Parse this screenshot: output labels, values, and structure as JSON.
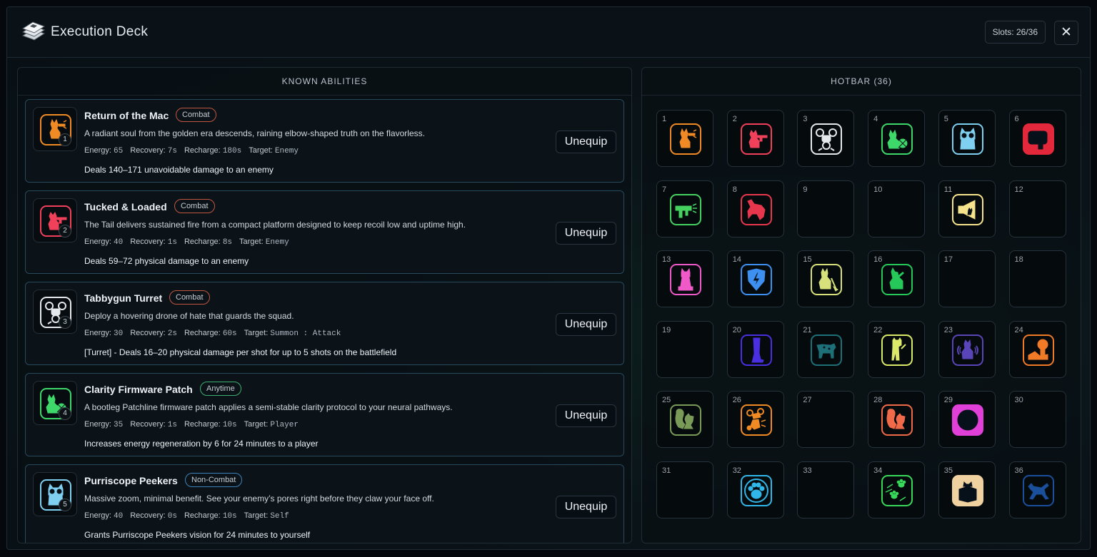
{
  "header": {
    "title": "Execution Deck",
    "slots": "Slots: 26/36",
    "close": "✕"
  },
  "known": {
    "title": "KNOWN ABILITIES"
  },
  "hotbar": {
    "title": "HOTBAR (36)"
  },
  "labels": {
    "energy": "Energy:",
    "recovery": "Recovery:",
    "recharge": "Recharge:",
    "target": "Target:",
    "unequip": "Unequip"
  },
  "abilities": [
    {
      "name": "Return of the Mac",
      "tag": "Combat",
      "tag_kind": "combat",
      "slot": "1",
      "desc": "A radiant soul from the golden era descends, raining elbow-shaped truth on the flavorless.",
      "energy": "65",
      "recovery": "7s",
      "recharge": "180s",
      "target": "Enemy",
      "effect": "Deals 140–171 unavoidable damage to an enemy",
      "color": "#f08a24",
      "icon": "cat-gun-icon"
    },
    {
      "name": "Tucked & Loaded",
      "tag": "Combat",
      "tag_kind": "combat",
      "slot": "2",
      "desc": "The Tail delivers sustained fire from a compact platform designed to keep recoil low and uptime high.",
      "energy": "40",
      "recovery": "1s",
      "recharge": "8s",
      "target": "Enemy",
      "effect": "Deals 59–72 physical damage to an enemy",
      "color": "#f0405a",
      "icon": "cat-rifle-icon"
    },
    {
      "name": "Tabbygun Turret",
      "tag": "Combat",
      "tag_kind": "combat",
      "slot": "3",
      "desc": "Deploy a hovering drone of hate that guards the squad.",
      "energy": "30",
      "recovery": "2s",
      "recharge": "60s",
      "target": "Summon : Attack",
      "effect": "[Turret] - Deals 16–20 physical damage per shot for up to 5 shots on the battlefield",
      "color": "#e6e9ec",
      "icon": "drone-icon"
    },
    {
      "name": "Clarity Firmware Patch",
      "tag": "Anytime",
      "tag_kind": "anytime",
      "slot": "4",
      "desc": "A bootleg Patchline firmware patch applies a semi-stable clarity protocol to your neural pathways.",
      "energy": "35",
      "recovery": "1s",
      "recharge": "10s",
      "target": "Player",
      "effect": "Increases energy regeneration by 6 for 24 minutes to a player",
      "color": "#3ed86a",
      "icon": "cat-chip-icon"
    },
    {
      "name": "Purriscope Peekers",
      "tag": "Non-Combat",
      "tag_kind": "noncombat",
      "slot": "5",
      "desc": "Massive zoom, minimal benefit. See your enemy’s pores right before they claw your face off.",
      "energy": "40",
      "recovery": "0s",
      "recharge": "10s",
      "target": "Self",
      "effect": "Grants Purriscope Peekers vision for 24 minutes to yourself",
      "color": "#7fcff0",
      "icon": "cat-goggles-icon"
    }
  ],
  "slots": [
    {
      "n": "1",
      "color": "#f08a24",
      "icon": "cat-gun-icon",
      "fill": false
    },
    {
      "n": "2",
      "color": "#f0405a",
      "icon": "cat-rifle-icon",
      "fill": false
    },
    {
      "n": "3",
      "color": "#e6e9ec",
      "icon": "drone-icon",
      "fill": false
    },
    {
      "n": "4",
      "color": "#3ed86a",
      "icon": "cat-chip-icon",
      "fill": false
    },
    {
      "n": "5",
      "color": "#7fcff0",
      "icon": "cat-goggles-icon",
      "fill": false
    },
    {
      "n": "6",
      "color": "#e3283c",
      "icon": "launcher-icon",
      "fill": true
    },
    {
      "n": "7",
      "color": "#45d160",
      "icon": "smg-icon",
      "fill": false
    },
    {
      "n": "8",
      "color": "#e8364c",
      "icon": "pouncing-cat-icon",
      "fill": false
    },
    {
      "n": "9",
      "empty": true
    },
    {
      "n": "10",
      "empty": true
    },
    {
      "n": "11",
      "color": "#f6e48c",
      "icon": "cat-megaphone-icon",
      "fill": false
    },
    {
      "n": "12",
      "empty": true
    },
    {
      "n": "13",
      "color": "#ef5ac8",
      "icon": "cat-statue-icon",
      "fill": false
    },
    {
      "n": "14",
      "color": "#3d8ff0",
      "icon": "shield-bolt-icon",
      "fill": false
    },
    {
      "n": "15",
      "color": "#d7e07a",
      "icon": "cat-broom-icon",
      "fill": false
    },
    {
      "n": "16",
      "color": "#26c85a",
      "icon": "cat-grooming-icon",
      "fill": false
    },
    {
      "n": "17",
      "empty": true
    },
    {
      "n": "18",
      "empty": true
    },
    {
      "n": "19",
      "empty": true
    },
    {
      "n": "20",
      "color": "#4a2fe0",
      "icon": "cat-leg-icon",
      "fill": false
    },
    {
      "n": "21",
      "color": "#1d6f78",
      "icon": "cow-icon",
      "fill": false
    },
    {
      "n": "22",
      "color": "#dcea6a",
      "icon": "standing-cat-icon",
      "fill": false
    },
    {
      "n": "23",
      "color": "#5a45b8",
      "icon": "cat-radar-icon",
      "fill": false
    },
    {
      "n": "24",
      "color": "#f07a26",
      "icon": "explosion-icon",
      "fill": false
    },
    {
      "n": "25",
      "color": "#7a9a58",
      "icon": "squirrel-icon",
      "fill": false
    },
    {
      "n": "26",
      "color": "#f08a24",
      "icon": "cat-drone-strike-icon",
      "fill": false
    },
    {
      "n": "27",
      "empty": true
    },
    {
      "n": "28",
      "color": "#f06a4a",
      "icon": "squirrel-icon",
      "fill": false
    },
    {
      "n": "29",
      "color": "#e040d8",
      "icon": "donut-icon",
      "fill": true
    },
    {
      "n": "30",
      "empty": true
    },
    {
      "n": "31",
      "empty": true
    },
    {
      "n": "32",
      "color": "#30b6e8",
      "icon": "paw-icon",
      "fill": false
    },
    {
      "n": "33",
      "empty": true
    },
    {
      "n": "34",
      "color": "#38d85a",
      "icon": "paw-dash-icon",
      "fill": false
    },
    {
      "n": "35",
      "color": "#f0d2a0",
      "icon": "cat-box-icon",
      "fill": true
    },
    {
      "n": "36",
      "color": "#1a4f9c",
      "icon": "running-cat-icon",
      "fill": false
    }
  ]
}
